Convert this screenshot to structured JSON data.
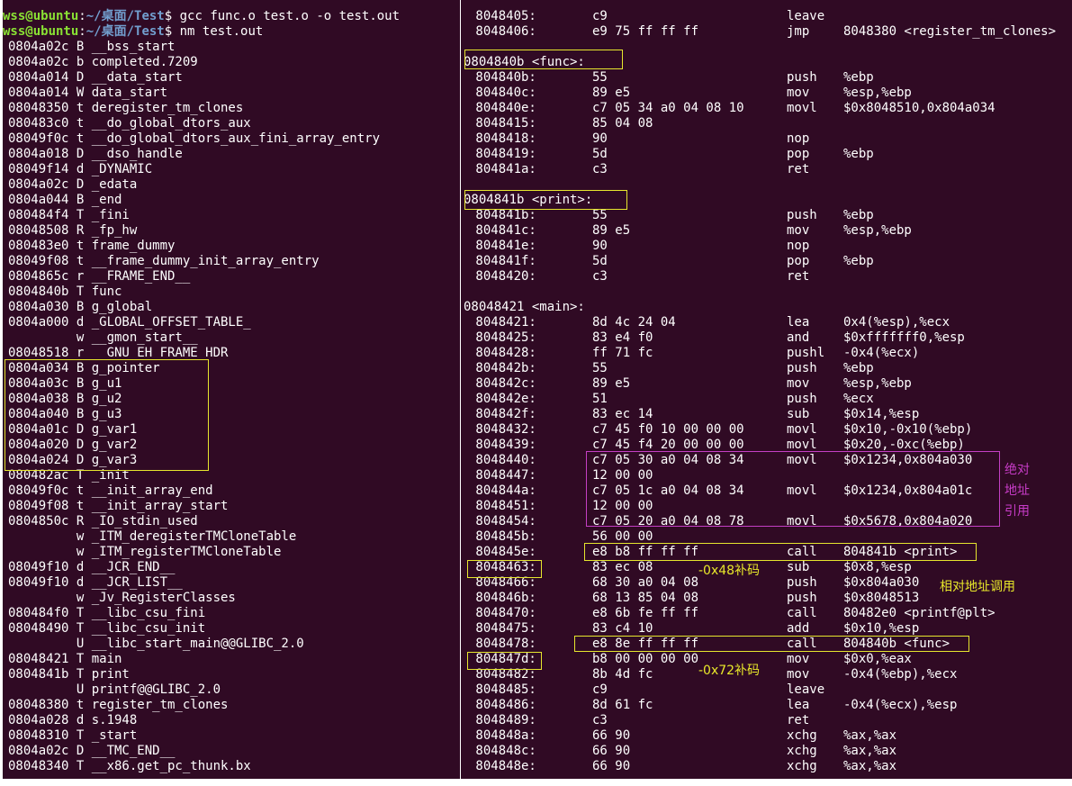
{
  "left_terminal": {
    "prompt_user": "wss@ubuntu",
    "prompt_path": "~/桌面/Test",
    "commands": [
      "gcc func.o test.o -o test.out",
      "nm test.out"
    ],
    "nm_output": [
      "0804a02c B __bss_start",
      "0804a02c b completed.7209",
      "0804a014 D __data_start",
      "0804a014 W data_start",
      "08048350 t deregister_tm_clones",
      "080483c0 t __do_global_dtors_aux",
      "08049f0c t __do_global_dtors_aux_fini_array_entry",
      "0804a018 D __dso_handle",
      "08049f14 d _DYNAMIC",
      "0804a02c D _edata",
      "0804a044 B _end",
      "080484f4 T _fini",
      "08048508 R _fp_hw",
      "080483e0 t frame_dummy",
      "08049f08 t __frame_dummy_init_array_entry",
      "0804865c r __FRAME_END__",
      "0804840b T func",
      "0804a030 B g_global",
      "0804a000 d _GLOBAL_OFFSET_TABLE_",
      "         w __gmon_start__",
      "08048518 r __GNU_EH_FRAME_HDR",
      "0804a034 B g_pointer",
      "0804a03c B g_u1",
      "0804a038 B g_u2",
      "0804a040 B g_u3",
      "0804a01c D g_var1",
      "0804a020 D g_var2",
      "0804a024 D g_var3",
      "080482ac T _init",
      "08049f0c t __init_array_end",
      "08049f08 t __init_array_start",
      "0804850c R _IO_stdin_used",
      "         w _ITM_deregisterTMCloneTable",
      "         w _ITM_registerTMCloneTable",
      "08049f10 d __JCR_END__",
      "08049f10 d __JCR_LIST__",
      "         w _Jv_RegisterClasses",
      "080484f0 T __libc_csu_fini",
      "08048490 T __libc_csu_init",
      "         U __libc_start_main@@GLIBC_2.0",
      "08048421 T main",
      "0804841b T print",
      "         U printf@@GLIBC_2.0",
      "08048380 t register_tm_clones",
      "0804a028 d s.1948",
      "08048310 T _start",
      "0804a02c D __TMC_END__",
      "08048340 T __x86.get_pc_thunk.bx"
    ]
  },
  "right_terminal": {
    "lines": [
      {
        "addr": " 8048405:",
        "bytes": "c9",
        "mn": "leave",
        "op": ""
      },
      {
        "addr": " 8048406:",
        "bytes": "e9 75 ff ff ff",
        "mn": "jmp",
        "op": "8048380 <register_tm_clones>"
      },
      {
        "label": ""
      },
      {
        "label": "0804840b <func>:"
      },
      {
        "addr": " 804840b:",
        "bytes": "55",
        "mn": "push",
        "op": "%ebp"
      },
      {
        "addr": " 804840c:",
        "bytes": "89 e5",
        "mn": "mov",
        "op": "%esp,%ebp"
      },
      {
        "addr": " 804840e:",
        "bytes": "c7 05 34 a0 04 08 10",
        "mn": "movl",
        "op": "$0x8048510,0x804a034"
      },
      {
        "addr": " 8048415:",
        "bytes": "85 04 08",
        "mn": "",
        "op": ""
      },
      {
        "addr": " 8048418:",
        "bytes": "90",
        "mn": "nop",
        "op": ""
      },
      {
        "addr": " 8048419:",
        "bytes": "5d",
        "mn": "pop",
        "op": "%ebp"
      },
      {
        "addr": " 804841a:",
        "bytes": "c3",
        "mn": "ret",
        "op": ""
      },
      {
        "label": ""
      },
      {
        "label": "0804841b <print>:"
      },
      {
        "addr": " 804841b:",
        "bytes": "55",
        "mn": "push",
        "op": "%ebp"
      },
      {
        "addr": " 804841c:",
        "bytes": "89 e5",
        "mn": "mov",
        "op": "%esp,%ebp"
      },
      {
        "addr": " 804841e:",
        "bytes": "90",
        "mn": "nop",
        "op": ""
      },
      {
        "addr": " 804841f:",
        "bytes": "5d",
        "mn": "pop",
        "op": "%ebp"
      },
      {
        "addr": " 8048420:",
        "bytes": "c3",
        "mn": "ret",
        "op": ""
      },
      {
        "label": ""
      },
      {
        "label": "08048421 <main>:"
      },
      {
        "addr": " 8048421:",
        "bytes": "8d 4c 24 04",
        "mn": "lea",
        "op": "0x4(%esp),%ecx"
      },
      {
        "addr": " 8048425:",
        "bytes": "83 e4 f0",
        "mn": "and",
        "op": "$0xfffffff0,%esp"
      },
      {
        "addr": " 8048428:",
        "bytes": "ff 71 fc",
        "mn": "pushl",
        "op": "-0x4(%ecx)"
      },
      {
        "addr": " 804842b:",
        "bytes": "55",
        "mn": "push",
        "op": "%ebp"
      },
      {
        "addr": " 804842c:",
        "bytes": "89 e5",
        "mn": "mov",
        "op": "%esp,%ebp"
      },
      {
        "addr": " 804842e:",
        "bytes": "51",
        "mn": "push",
        "op": "%ecx"
      },
      {
        "addr": " 804842f:",
        "bytes": "83 ec 14",
        "mn": "sub",
        "op": "$0x14,%esp"
      },
      {
        "addr": " 8048432:",
        "bytes": "c7 45 f0 10 00 00 00",
        "mn": "movl",
        "op": "$0x10,-0x10(%ebp)"
      },
      {
        "addr": " 8048439:",
        "bytes": "c7 45 f4 20 00 00 00",
        "mn": "movl",
        "op": "$0x20,-0xc(%ebp)"
      },
      {
        "addr": " 8048440:",
        "bytes": "c7 05 30 a0 04 08 34",
        "mn": "movl",
        "op": "$0x1234,0x804a030"
      },
      {
        "addr": " 8048447:",
        "bytes": "12 00 00",
        "mn": "",
        "op": ""
      },
      {
        "addr": " 804844a:",
        "bytes": "c7 05 1c a0 04 08 34",
        "mn": "movl",
        "op": "$0x1234,0x804a01c"
      },
      {
        "addr": " 8048451:",
        "bytes": "12 00 00",
        "mn": "",
        "op": ""
      },
      {
        "addr": " 8048454:",
        "bytes": "c7 05 20 a0 04 08 78",
        "mn": "movl",
        "op": "$0x5678,0x804a020"
      },
      {
        "addr": " 804845b:",
        "bytes": "56 00 00",
        "mn": "",
        "op": ""
      },
      {
        "addr": " 804845e:",
        "bytes": "e8 b8 ff ff ff",
        "mn": "call",
        "op": "804841b <print>"
      },
      {
        "addr": " 8048463:",
        "bytes": "83 ec 08",
        "mn": "sub",
        "op": "$0x8,%esp"
      },
      {
        "addr": " 8048466:",
        "bytes": "68 30 a0 04 08",
        "mn": "push",
        "op": "$0x804a030"
      },
      {
        "addr": " 804846b:",
        "bytes": "68 13 85 04 08",
        "mn": "push",
        "op": "$0x8048513"
      },
      {
        "addr": " 8048470:",
        "bytes": "e8 6b fe ff ff",
        "mn": "call",
        "op": "80482e0 <printf@plt>"
      },
      {
        "addr": " 8048475:",
        "bytes": "83 c4 10",
        "mn": "add",
        "op": "$0x10,%esp"
      },
      {
        "addr": " 8048478:",
        "bytes": "e8 8e ff ff ff",
        "mn": "call",
        "op": "804840b <func>"
      },
      {
        "addr": " 804847d:",
        "bytes": "b8 00 00 00 00",
        "mn": "mov",
        "op": "$0x0,%eax"
      },
      {
        "addr": " 8048482:",
        "bytes": "8b 4d fc",
        "mn": "mov",
        "op": "-0x4(%ebp),%ecx"
      },
      {
        "addr": " 8048485:",
        "bytes": "c9",
        "mn": "leave",
        "op": ""
      },
      {
        "addr": " 8048486:",
        "bytes": "8d 61 fc",
        "mn": "lea",
        "op": "-0x4(%ecx),%esp"
      },
      {
        "addr": " 8048489:",
        "bytes": "c3",
        "mn": "ret",
        "op": ""
      },
      {
        "addr": " 804848a:",
        "bytes": "66 90",
        "mn": "xchg",
        "op": "%ax,%ax"
      },
      {
        "addr": " 804848c:",
        "bytes": "66 90",
        "mn": "xchg",
        "op": "%ax,%ax"
      },
      {
        "addr": " 804848e:",
        "bytes": "66 90",
        "mn": "xchg",
        "op": "%ax,%ax"
      }
    ]
  },
  "annotations": {
    "absolute_ref": "绝对地址引用",
    "relative_call": "相对地址调用",
    "complement_48": "-0x48补码",
    "complement_72": "-0x72补码"
  },
  "colors": {
    "terminal_bg": "#300a24",
    "prompt_user": "#8ae234",
    "prompt_path": "#729fcf",
    "highlight_yellow": "#e6e62e",
    "highlight_magenta": "#c43fc4"
  }
}
